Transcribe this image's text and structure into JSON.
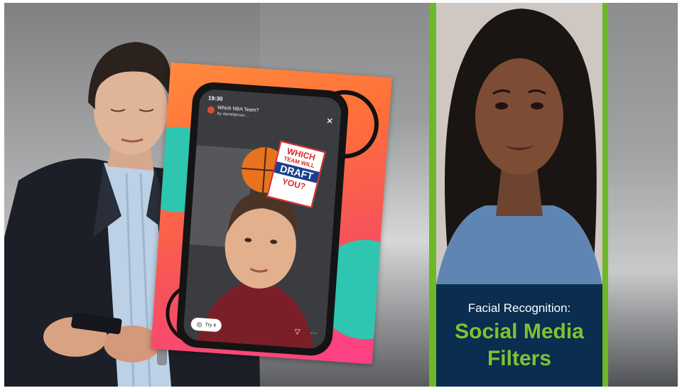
{
  "phone": {
    "time": "19:30",
    "filter_title": "Which NBA Team?",
    "filter_author": "by danielprvan…",
    "sticker_line1": "WHICH",
    "sticker_line2": "TEAM WILL",
    "sticker_line3": "DRAFT",
    "sticker_line4": "YOU?",
    "try_button": "Try it",
    "more": "···"
  },
  "caption": {
    "subtitle": "Facial Recognition:",
    "title_line1": "Social Media",
    "title_line2": "Filters"
  },
  "colors": {
    "accent_green": "#6db829",
    "caption_bg": "#0b2d4f",
    "title_green": "#7cc433"
  }
}
